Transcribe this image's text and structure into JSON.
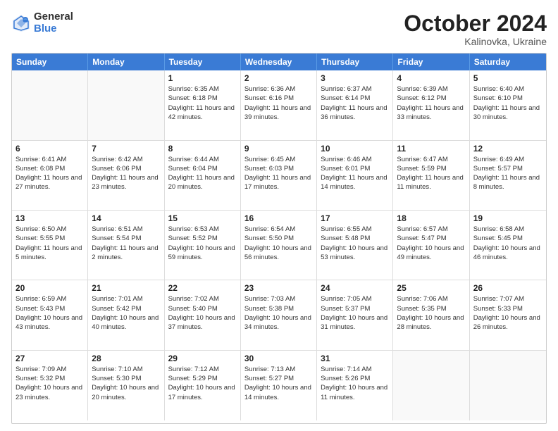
{
  "logo": {
    "general": "General",
    "blue": "Blue"
  },
  "title": "October 2024",
  "location": "Kalinovka, Ukraine",
  "days": [
    "Sunday",
    "Monday",
    "Tuesday",
    "Wednesday",
    "Thursday",
    "Friday",
    "Saturday"
  ],
  "weeks": [
    [
      {
        "day": "",
        "info": ""
      },
      {
        "day": "",
        "info": ""
      },
      {
        "day": "1",
        "info": "Sunrise: 6:35 AM\nSunset: 6:18 PM\nDaylight: 11 hours and 42 minutes."
      },
      {
        "day": "2",
        "info": "Sunrise: 6:36 AM\nSunset: 6:16 PM\nDaylight: 11 hours and 39 minutes."
      },
      {
        "day": "3",
        "info": "Sunrise: 6:37 AM\nSunset: 6:14 PM\nDaylight: 11 hours and 36 minutes."
      },
      {
        "day": "4",
        "info": "Sunrise: 6:39 AM\nSunset: 6:12 PM\nDaylight: 11 hours and 33 minutes."
      },
      {
        "day": "5",
        "info": "Sunrise: 6:40 AM\nSunset: 6:10 PM\nDaylight: 11 hours and 30 minutes."
      }
    ],
    [
      {
        "day": "6",
        "info": "Sunrise: 6:41 AM\nSunset: 6:08 PM\nDaylight: 11 hours and 27 minutes."
      },
      {
        "day": "7",
        "info": "Sunrise: 6:42 AM\nSunset: 6:06 PM\nDaylight: 11 hours and 23 minutes."
      },
      {
        "day": "8",
        "info": "Sunrise: 6:44 AM\nSunset: 6:04 PM\nDaylight: 11 hours and 20 minutes."
      },
      {
        "day": "9",
        "info": "Sunrise: 6:45 AM\nSunset: 6:03 PM\nDaylight: 11 hours and 17 minutes."
      },
      {
        "day": "10",
        "info": "Sunrise: 6:46 AM\nSunset: 6:01 PM\nDaylight: 11 hours and 14 minutes."
      },
      {
        "day": "11",
        "info": "Sunrise: 6:47 AM\nSunset: 5:59 PM\nDaylight: 11 hours and 11 minutes."
      },
      {
        "day": "12",
        "info": "Sunrise: 6:49 AM\nSunset: 5:57 PM\nDaylight: 11 hours and 8 minutes."
      }
    ],
    [
      {
        "day": "13",
        "info": "Sunrise: 6:50 AM\nSunset: 5:55 PM\nDaylight: 11 hours and 5 minutes."
      },
      {
        "day": "14",
        "info": "Sunrise: 6:51 AM\nSunset: 5:54 PM\nDaylight: 11 hours and 2 minutes."
      },
      {
        "day": "15",
        "info": "Sunrise: 6:53 AM\nSunset: 5:52 PM\nDaylight: 10 hours and 59 minutes."
      },
      {
        "day": "16",
        "info": "Sunrise: 6:54 AM\nSunset: 5:50 PM\nDaylight: 10 hours and 56 minutes."
      },
      {
        "day": "17",
        "info": "Sunrise: 6:55 AM\nSunset: 5:48 PM\nDaylight: 10 hours and 53 minutes."
      },
      {
        "day": "18",
        "info": "Sunrise: 6:57 AM\nSunset: 5:47 PM\nDaylight: 10 hours and 49 minutes."
      },
      {
        "day": "19",
        "info": "Sunrise: 6:58 AM\nSunset: 5:45 PM\nDaylight: 10 hours and 46 minutes."
      }
    ],
    [
      {
        "day": "20",
        "info": "Sunrise: 6:59 AM\nSunset: 5:43 PM\nDaylight: 10 hours and 43 minutes."
      },
      {
        "day": "21",
        "info": "Sunrise: 7:01 AM\nSunset: 5:42 PM\nDaylight: 10 hours and 40 minutes."
      },
      {
        "day": "22",
        "info": "Sunrise: 7:02 AM\nSunset: 5:40 PM\nDaylight: 10 hours and 37 minutes."
      },
      {
        "day": "23",
        "info": "Sunrise: 7:03 AM\nSunset: 5:38 PM\nDaylight: 10 hours and 34 minutes."
      },
      {
        "day": "24",
        "info": "Sunrise: 7:05 AM\nSunset: 5:37 PM\nDaylight: 10 hours and 31 minutes."
      },
      {
        "day": "25",
        "info": "Sunrise: 7:06 AM\nSunset: 5:35 PM\nDaylight: 10 hours and 28 minutes."
      },
      {
        "day": "26",
        "info": "Sunrise: 7:07 AM\nSunset: 5:33 PM\nDaylight: 10 hours and 26 minutes."
      }
    ],
    [
      {
        "day": "27",
        "info": "Sunrise: 7:09 AM\nSunset: 5:32 PM\nDaylight: 10 hours and 23 minutes."
      },
      {
        "day": "28",
        "info": "Sunrise: 7:10 AM\nSunset: 5:30 PM\nDaylight: 10 hours and 20 minutes."
      },
      {
        "day": "29",
        "info": "Sunrise: 7:12 AM\nSunset: 5:29 PM\nDaylight: 10 hours and 17 minutes."
      },
      {
        "day": "30",
        "info": "Sunrise: 7:13 AM\nSunset: 5:27 PM\nDaylight: 10 hours and 14 minutes."
      },
      {
        "day": "31",
        "info": "Sunrise: 7:14 AM\nSunset: 5:26 PM\nDaylight: 10 hours and 11 minutes."
      },
      {
        "day": "",
        "info": ""
      },
      {
        "day": "",
        "info": ""
      }
    ]
  ]
}
